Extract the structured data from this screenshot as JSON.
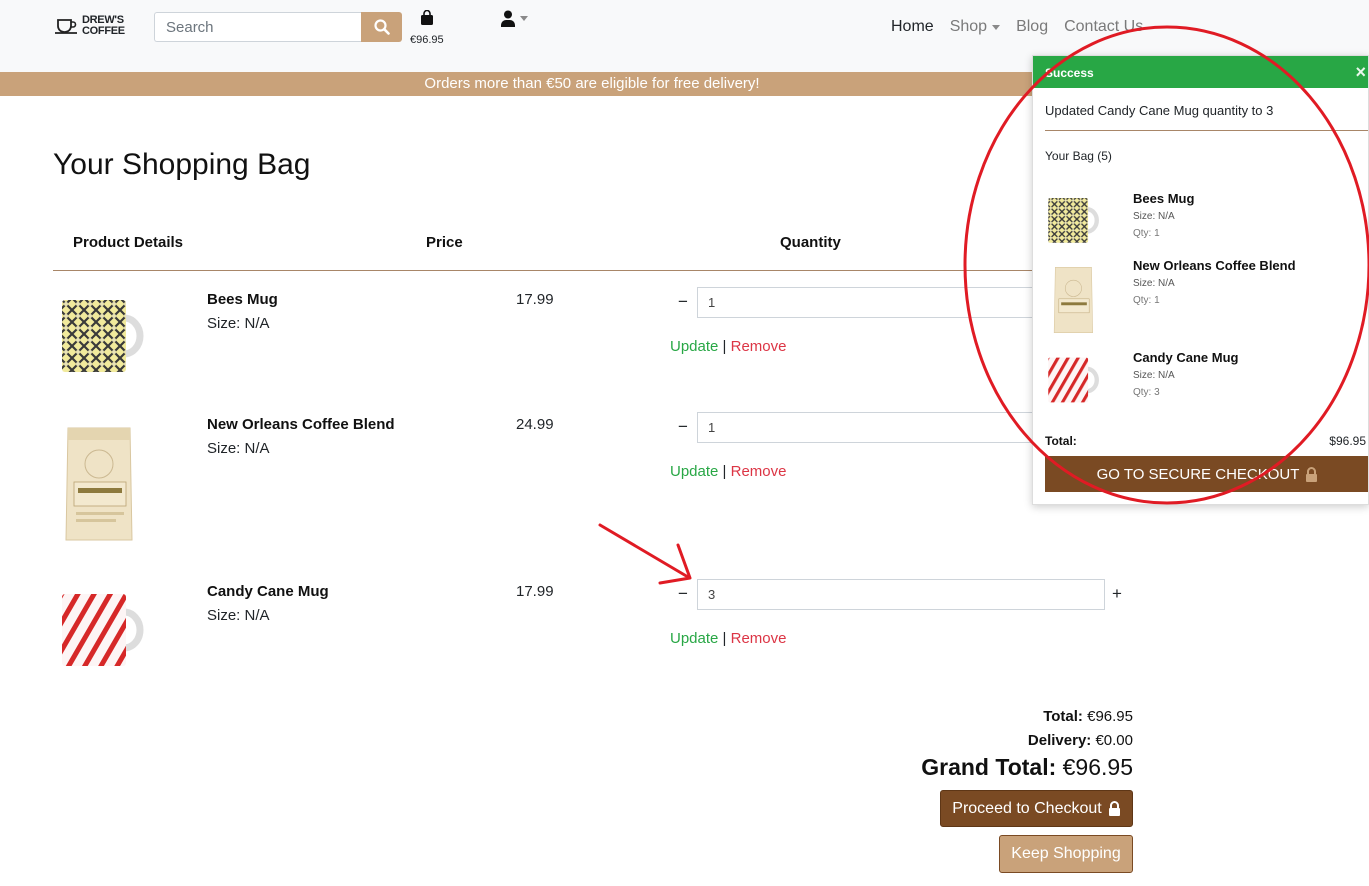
{
  "header": {
    "logo_line1": "DREW'S",
    "logo_line2": "COFFEE",
    "search_placeholder": "Search",
    "bag_total": "€96.95",
    "nav": {
      "home": "Home",
      "shop": "Shop",
      "blog": "Blog",
      "contact": "Contact Us"
    }
  },
  "banner": "Orders more than €50 are eligible for free delivery!",
  "page_title": "Your Shopping Bag",
  "table_headers": {
    "product": "Product Details",
    "price": "Price",
    "quantity": "Quantity"
  },
  "items": [
    {
      "name": "Bees Mug",
      "size": "Size: N/A",
      "price": "17.99",
      "qty": "1"
    },
    {
      "name": "New Orleans Coffee Blend",
      "size": "Size: N/A",
      "price": "24.99",
      "qty": "1"
    },
    {
      "name": "Candy Cane Mug",
      "size": "Size: N/A",
      "price": "17.99",
      "qty": "3"
    }
  ],
  "row_actions": {
    "update": "Update",
    "separator": "|",
    "remove": "Remove",
    "minus": "−",
    "plus": "+"
  },
  "totals": {
    "total_label": "Total:",
    "total_value": "€96.95",
    "delivery_label": "Delivery:",
    "delivery_value": "€0.00",
    "grand_label": "Grand Total:",
    "grand_value": "€96.95"
  },
  "buttons": {
    "checkout": "Proceed to Checkout",
    "keep_shopping": "Keep Shopping"
  },
  "toast": {
    "title": "Success",
    "close": "×",
    "message": "Updated Candy Cane Mug quantity to 3",
    "bag_label": "Your Bag (5)",
    "items": [
      {
        "name": "Bees Mug",
        "size": "Size: N/A",
        "qty": "Qty: 1"
      },
      {
        "name": "New Orleans Coffee Blend",
        "size": "Size: N/A",
        "qty": "Qty: 1"
      },
      {
        "name": "Candy Cane Mug",
        "size": "Size: N/A",
        "qty": "Qty: 3"
      }
    ],
    "total_label": "Total:",
    "total_value": "$96.95",
    "checkout_button": "GO TO SECURE CHECKOUT"
  },
  "colors": {
    "brand_tan": "#c9a27a",
    "brand_brown": "#7a4a23",
    "success_green": "#28a745",
    "remove_red": "#dc3545",
    "annotation_red": "#e01b24"
  },
  "icons": [
    "coffee-cup-icon",
    "search-icon",
    "shopping-bag-icon",
    "user-icon",
    "lock-icon",
    "close-icon"
  ]
}
